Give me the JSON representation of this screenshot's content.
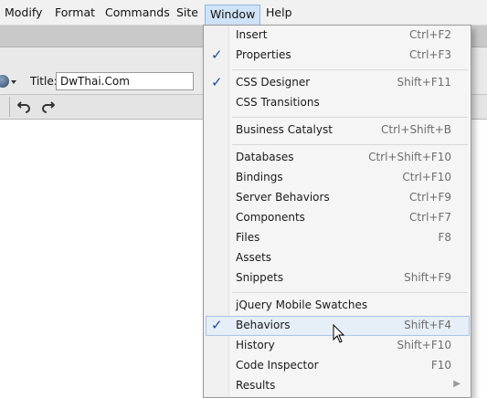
{
  "menubar": {
    "items": [
      {
        "label": "Modify"
      },
      {
        "label": "Format"
      },
      {
        "label": "Commands"
      },
      {
        "label": "Site"
      },
      {
        "label": "Window",
        "active": true
      },
      {
        "label": "Help"
      }
    ]
  },
  "toolbar": {
    "title_label": "Title:",
    "title_value": "DwThai.Com"
  },
  "window_menu": {
    "items": [
      {
        "label": "Insert",
        "shortcut": "Ctrl+F2",
        "checked": false
      },
      {
        "label": "Properties",
        "shortcut": "Ctrl+F3",
        "checked": true
      },
      {
        "label": "CSS Designer",
        "shortcut": "Shift+F11",
        "checked": true
      },
      {
        "label": "CSS Transitions",
        "shortcut": "",
        "checked": false
      },
      {
        "label": "Business Catalyst",
        "shortcut": "Ctrl+Shift+B",
        "checked": false
      },
      {
        "label": "Databases",
        "shortcut": "Ctrl+Shift+F10",
        "checked": false
      },
      {
        "label": "Bindings",
        "shortcut": "Ctrl+F10",
        "checked": false
      },
      {
        "label": "Server Behaviors",
        "shortcut": "Ctrl+F9",
        "checked": false
      },
      {
        "label": "Components",
        "shortcut": "Ctrl+F7",
        "checked": false
      },
      {
        "label": "Files",
        "shortcut": "F8",
        "checked": false
      },
      {
        "label": "Assets",
        "shortcut": "",
        "checked": false
      },
      {
        "label": "Snippets",
        "shortcut": "Shift+F9",
        "checked": false
      },
      {
        "label": "jQuery Mobile Swatches",
        "shortcut": "",
        "checked": false
      },
      {
        "label": "Behaviors",
        "shortcut": "Shift+F4",
        "checked": true,
        "highlighted": true
      },
      {
        "label": "History",
        "shortcut": "Shift+F10",
        "checked": false
      },
      {
        "label": "Code Inspector",
        "shortcut": "F10",
        "checked": false
      },
      {
        "label": "Results",
        "shortcut": "",
        "checked": false,
        "submenu": true
      }
    ]
  },
  "colors": {
    "highlight_bg": "#e6eef8",
    "highlight_border": "#a9c4e6",
    "check_color": "#1f4aa0",
    "active_menu_bg": "#cfe3f6"
  },
  "icons": {
    "check": "checkmark-icon",
    "submenu": "chevron-right-icon",
    "undo": "undo-icon",
    "redo": "redo-icon",
    "globe": "globe-icon",
    "cursor": "mouse-pointer-icon"
  }
}
